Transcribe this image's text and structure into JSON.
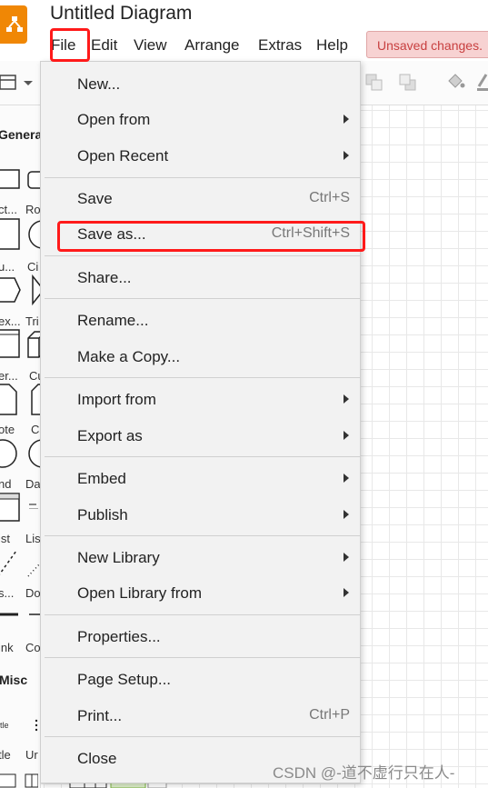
{
  "app": {
    "title": "Untitled Diagram",
    "unsaved_label": "Unsaved changes.",
    "accent": "#f08705"
  },
  "menubar": {
    "items": [
      "File",
      "Edit",
      "View",
      "Arrange",
      "Extras",
      "Help"
    ]
  },
  "sidebar": {
    "general_header": "Genera",
    "misc_header": "Misc",
    "labels": [
      "ct...",
      "Ro",
      "u...",
      "Ci",
      "ex...",
      "Tri",
      "er...",
      "Cu",
      "ote",
      "Ca",
      "nd",
      "Da",
      "ist",
      "Lis",
      "s...",
      "Do",
      "ink",
      "Co",
      "itle",
      "Un",
      "tle",
      "Ur"
    ]
  },
  "file_menu": {
    "items": [
      {
        "label": "New...",
        "shortcut": "",
        "submenu": false
      },
      {
        "label": "Open from",
        "shortcut": "",
        "submenu": true
      },
      {
        "label": "Open Recent",
        "shortcut": "",
        "submenu": true
      },
      {
        "label": "Save",
        "shortcut": "Ctrl+S",
        "submenu": false
      },
      {
        "label": "Save as...",
        "shortcut": "Ctrl+Shift+S",
        "submenu": false
      },
      {
        "label": "Share...",
        "shortcut": "",
        "submenu": false
      },
      {
        "label": "Rename...",
        "shortcut": "",
        "submenu": false
      },
      {
        "label": "Make a Copy...",
        "shortcut": "",
        "submenu": false
      },
      {
        "label": "Import from",
        "shortcut": "",
        "submenu": true
      },
      {
        "label": "Export as",
        "shortcut": "",
        "submenu": true
      },
      {
        "label": "Embed",
        "shortcut": "",
        "submenu": true
      },
      {
        "label": "Publish",
        "shortcut": "",
        "submenu": true
      },
      {
        "label": "New Library",
        "shortcut": "",
        "submenu": true
      },
      {
        "label": "Open Library from",
        "shortcut": "",
        "submenu": true
      },
      {
        "label": "Properties...",
        "shortcut": "",
        "submenu": false
      },
      {
        "label": "Page Setup...",
        "shortcut": "",
        "submenu": false
      },
      {
        "label": "Print...",
        "shortcut": "Ctrl+P",
        "submenu": false
      },
      {
        "label": "Close",
        "shortcut": "",
        "submenu": false
      }
    ]
  },
  "watermark": "CSDN @-道不虚行只在人-"
}
